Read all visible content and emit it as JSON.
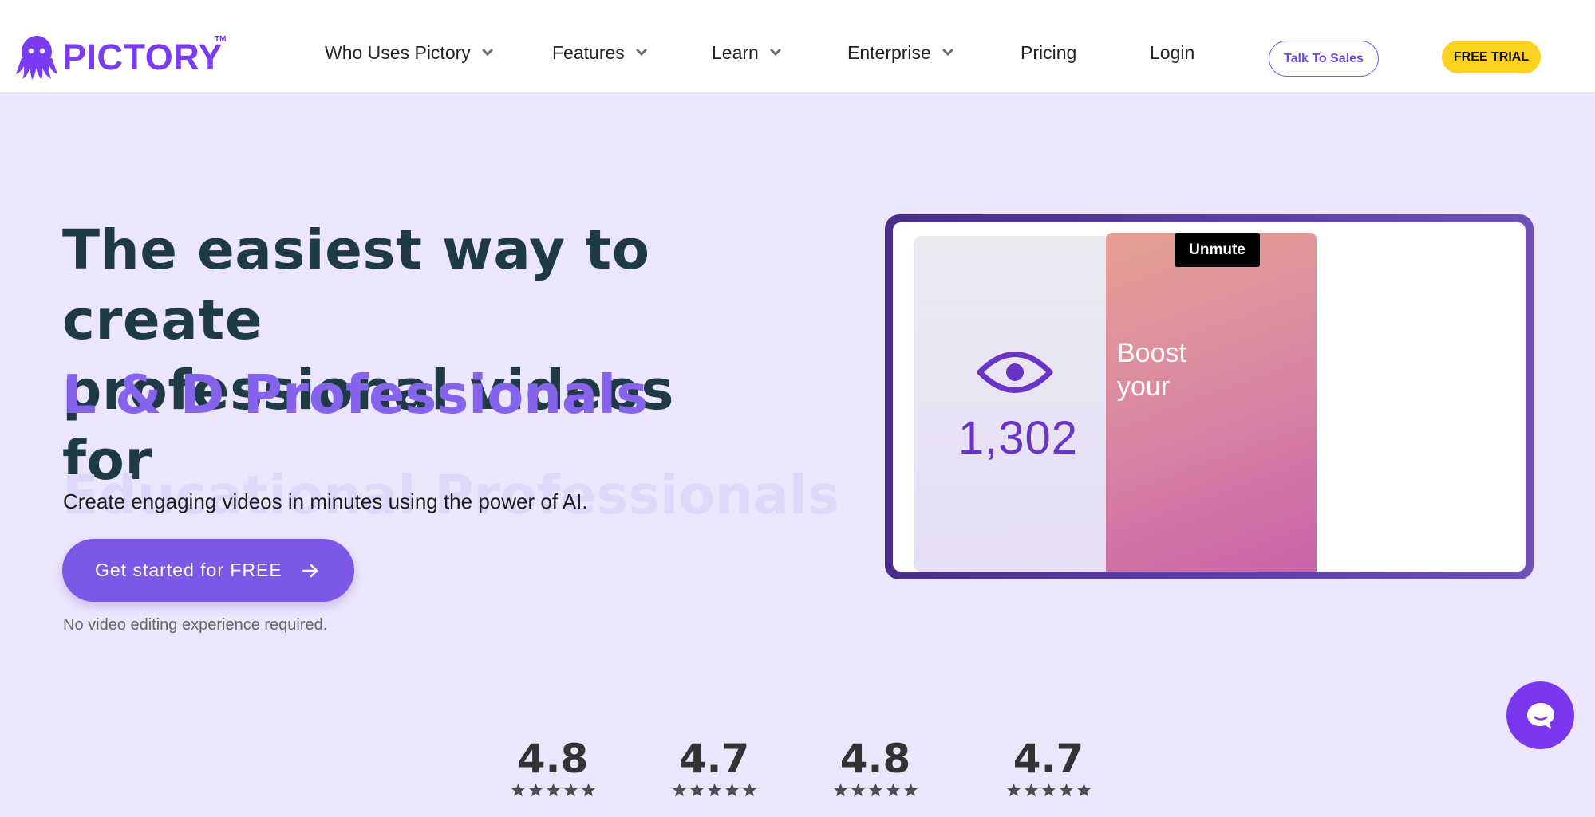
{
  "brand": {
    "name": "PICTORY",
    "tm": "TM",
    "color": "#7b3bf0"
  },
  "nav": {
    "items": [
      {
        "label": "Who Uses Pictory",
        "dropdown": true
      },
      {
        "label": "Features",
        "dropdown": true
      },
      {
        "label": "Learn",
        "dropdown": true
      },
      {
        "label": "Enterprise",
        "dropdown": true
      },
      {
        "label": "Pricing",
        "dropdown": false
      },
      {
        "label": "Login",
        "dropdown": false
      }
    ],
    "talk_to_sales": "Talk To Sales",
    "free_trial": "FREE TRIAL"
  },
  "hero": {
    "title_line1": "The easiest way to create",
    "title_line2": "professional videos for",
    "accent": "L & D Professionals",
    "ghost": "Educational Professionals",
    "subtitle": "Create engaging videos in minutes using the power of AI.",
    "cta_label": "Get started for FREE",
    "note": "No video editing experience required."
  },
  "preview": {
    "views": "1,302",
    "boost_line1": "Boost",
    "boost_line2": "your",
    "unmute_label": "Unmute"
  },
  "ratings": [
    {
      "value": "4.8",
      "stars": 5
    },
    {
      "value": "4.7",
      "stars": 5
    },
    {
      "value": "4.8",
      "stars": 5
    },
    {
      "value": "4.7",
      "stars": 5
    }
  ],
  "colors": {
    "background": "#ece6fd",
    "accent_purple": "#8563ec",
    "cta_purple": "#7d58e6",
    "trial_yellow": "#ffd21f",
    "heading": "#1d3a45"
  }
}
